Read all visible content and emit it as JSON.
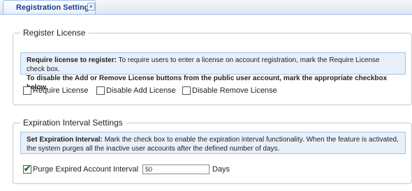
{
  "tab": {
    "title": "Registration Settings",
    "close_glyph": "×"
  },
  "register_license": {
    "legend": "Register License",
    "info_bold": "Require license to register:",
    "info_text": " To require users to enter a license on account registration, mark the Require License check box.",
    "info_line2": "To disable the Add or Remove License buttons from the public user account, mark the appropriate checkbox below.",
    "checkboxes": [
      {
        "label": "Require License",
        "checked": false
      },
      {
        "label": "Disable Add License",
        "checked": false
      },
      {
        "label": "Disable Remove License",
        "checked": false
      }
    ]
  },
  "expiration": {
    "legend": "Expiration Interval Settings",
    "info_bold": "Set Expiration Interval:",
    "info_text": " Mark the check box to enable the expiration interval functionality. When the feature is activated, the system purges all the inactive user accounts after the defined number of days.",
    "purge_label": "Purge Expired Account Interval",
    "purge_checked": true,
    "days_value": "50",
    "days_unit": "Days"
  },
  "icons": {
    "checkmark": "✔"
  }
}
